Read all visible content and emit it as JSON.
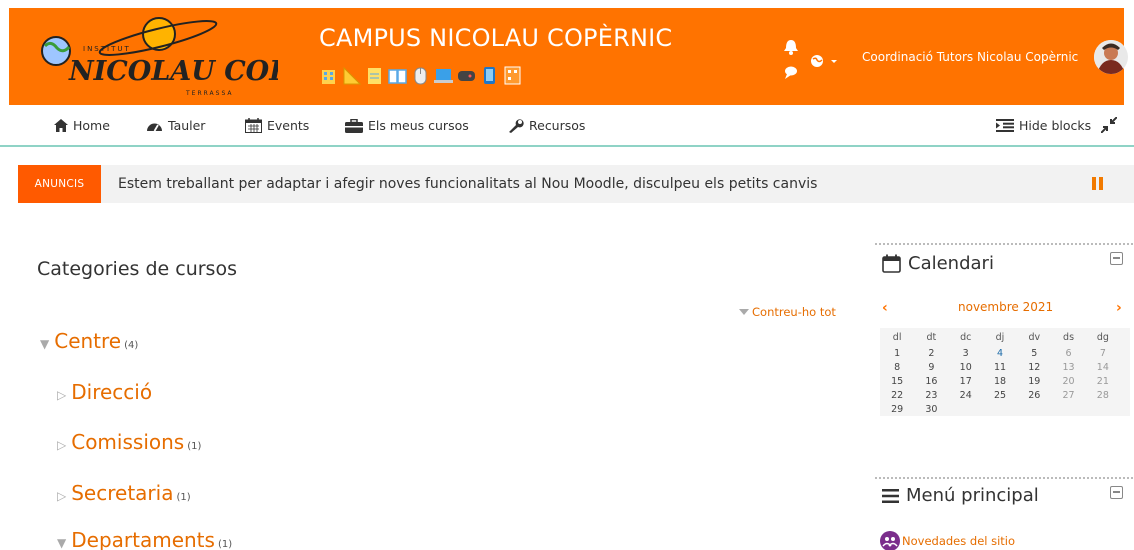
{
  "header": {
    "site_title": "CAMPUS NICOLAU COPÈRNIC",
    "logo_alt": "INSTITUT NICOLAU COPÈRNIC TERRASSA",
    "user_name": "Coordinació Tutors Nicolau Copèrnic",
    "icon_strip": [
      "building-icon",
      "ruler-icon",
      "notepad-icon",
      "book-icon",
      "mouse-icon",
      "laptop-icon",
      "gamepad-icon",
      "phone-icon",
      "qr-icon"
    ],
    "brand_color": "#ff7300"
  },
  "nav": {
    "home": "Home",
    "dashboard": "Tauler",
    "events": "Events",
    "my_courses": "Els meus cursos",
    "resources": "Recursos",
    "hide_blocks": "Hide blocks"
  },
  "announcement": {
    "tag": "ANUNCIS",
    "text": "Estem treballant per adaptar i afegir noves funcionalitats al Nou Moodle, disculpeu els petits canvis"
  },
  "main": {
    "heading": "Categories de cursos",
    "collapse_all": "Contreu-ho tot",
    "categories": [
      {
        "name": "Centre",
        "count": "(4)",
        "expanded": true
      },
      {
        "name": "Direcció",
        "count": "",
        "expanded": false
      },
      {
        "name": "Comissions",
        "count": "(1)",
        "expanded": false
      },
      {
        "name": "Secretaria",
        "count": "(1)",
        "expanded": false
      },
      {
        "name": "Departaments",
        "count": "(1)",
        "expanded": true
      }
    ]
  },
  "calendar": {
    "title": "Calendari",
    "month": "novembre 2021",
    "weekdays": [
      "dl",
      "dt",
      "dc",
      "dj",
      "dv",
      "ds",
      "dg"
    ],
    "weeks": [
      [
        "1",
        "2",
        "3",
        "4",
        "5",
        "6",
        "7"
      ],
      [
        "8",
        "9",
        "10",
        "11",
        "12",
        "13",
        "14"
      ],
      [
        "15",
        "16",
        "17",
        "18",
        "19",
        "20",
        "21"
      ],
      [
        "22",
        "23",
        "24",
        "25",
        "26",
        "27",
        "28"
      ],
      [
        "29",
        "30",
        "",
        "",
        "",
        "",
        ""
      ]
    ],
    "today": "4"
  },
  "main_menu": {
    "title": "Menú principal",
    "items": [
      {
        "label": "Novedades del sitio"
      }
    ]
  }
}
